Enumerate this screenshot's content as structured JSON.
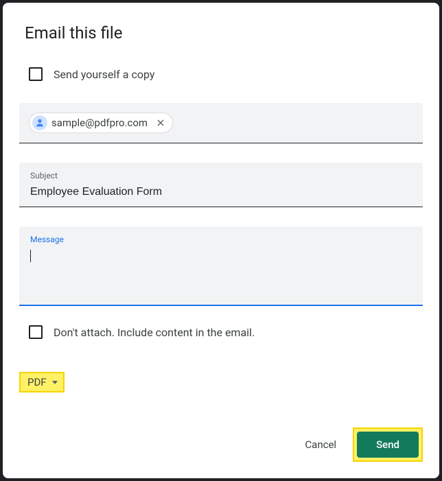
{
  "dialog": {
    "title": "Email this file"
  },
  "checkboxes": {
    "send_copy_label": "Send yourself a copy",
    "dont_attach_label": "Don't attach. Include content in the email."
  },
  "recipients": {
    "chip_email": "sample@pdfpro.com"
  },
  "subject": {
    "label": "Subject",
    "value": "Employee Evaluation Form"
  },
  "message": {
    "label": "Message",
    "value": ""
  },
  "format": {
    "selected": "PDF"
  },
  "buttons": {
    "cancel": "Cancel",
    "send": "Send"
  }
}
